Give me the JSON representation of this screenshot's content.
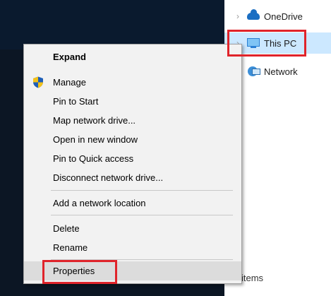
{
  "explorer": {
    "items": [
      {
        "label": "OneDrive",
        "icon": "onedrive-cloud-icon",
        "expander": "›"
      },
      {
        "label": "This PC",
        "icon": "monitor-icon",
        "expander": "›"
      },
      {
        "label": "Network",
        "icon": "network-icon",
        "expander": ""
      }
    ],
    "status_text": "items"
  },
  "context_menu": {
    "items": [
      {
        "label": "Expand",
        "bold": true
      },
      {
        "label": "Manage",
        "icon": "uac-shield-icon"
      },
      {
        "label": "Pin to Start"
      },
      {
        "label": "Map network drive..."
      },
      {
        "label": "Open in new window"
      },
      {
        "label": "Pin to Quick access"
      },
      {
        "label": "Disconnect network drive..."
      },
      {
        "label": "Add a network location"
      },
      {
        "label": "Delete"
      },
      {
        "label": "Rename"
      },
      {
        "label": "Properties",
        "hovered": true
      }
    ]
  },
  "colors": {
    "highlight_border": "#e0242b",
    "selected_row": "#cce8ff",
    "menu_background": "#f2f2f2",
    "menu_hover": "#dcdcdc"
  }
}
